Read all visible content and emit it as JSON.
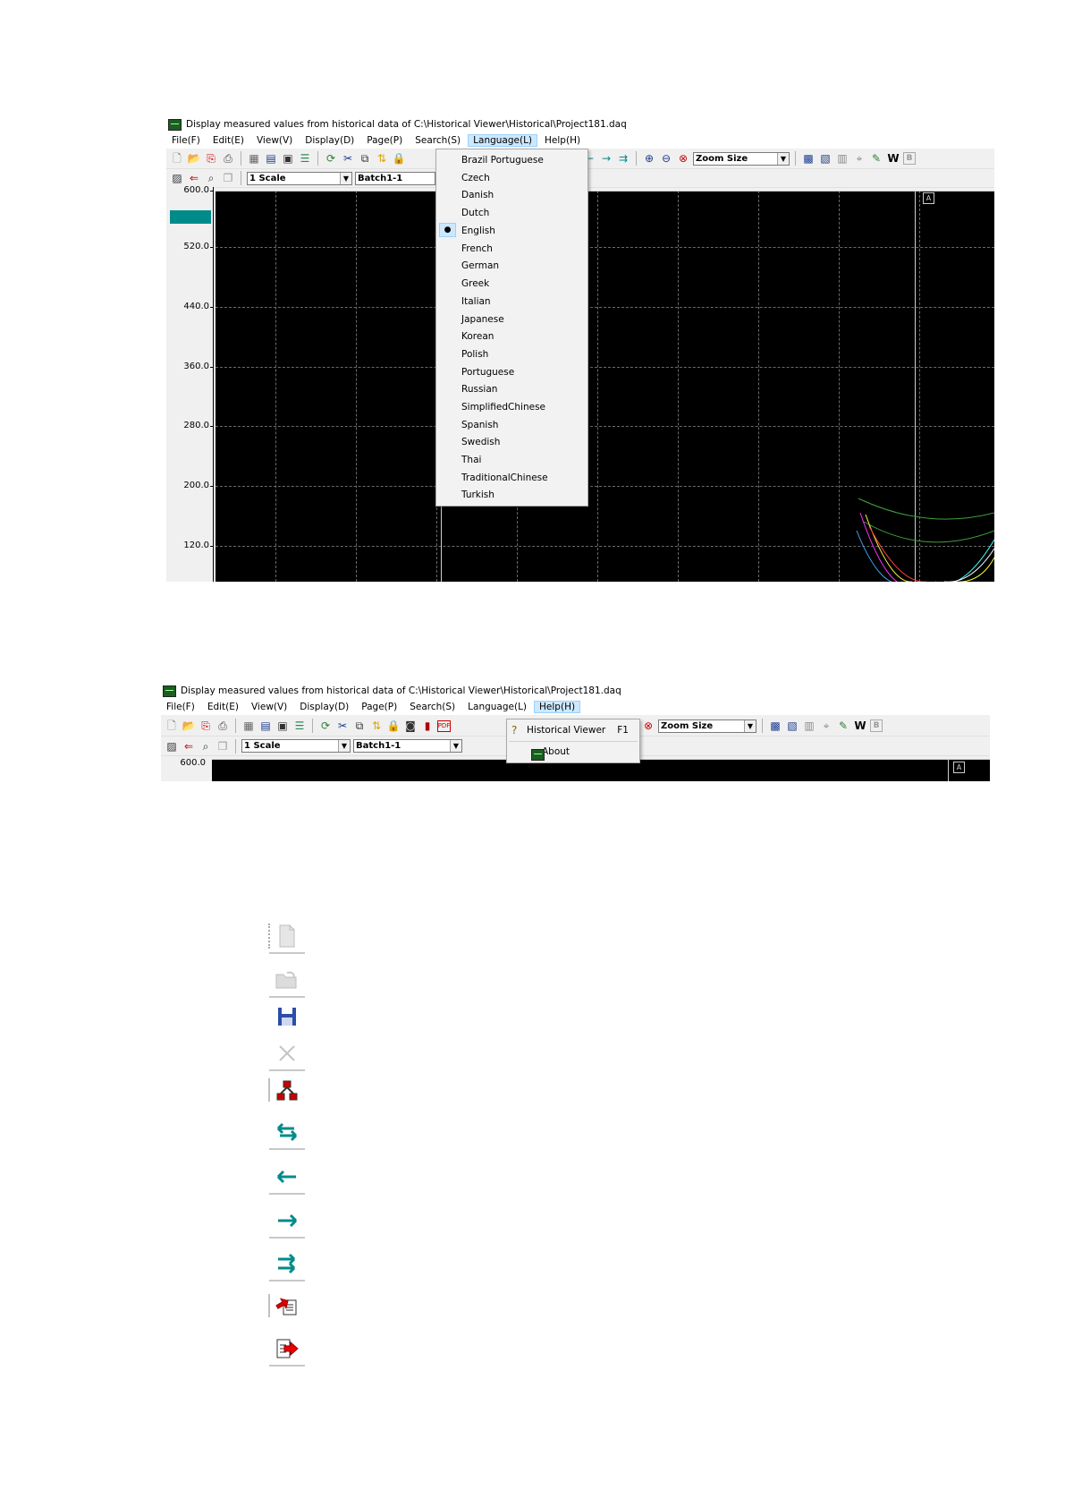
{
  "screen1": {
    "title": "Display measured values from historical data of C:\\Historical Viewer\\Historical\\Project181.daq",
    "menu": [
      "File(F)",
      "Edit(E)",
      "View(V)",
      "Display(D)",
      "Page(P)",
      "Search(S)",
      "Language(L)",
      "Help(H)"
    ],
    "open_menu": "Language(L)",
    "zoom_combo": "Zoom Size",
    "scale_combo": "1 Scale",
    "batch_combo": "Batch1-1",
    "w_label": "W",
    "b_label": "B",
    "marker_label": "A",
    "y_axis_labels": [
      "600.0",
      "520.0",
      "440.0",
      "360.0",
      "280.0",
      "200.0",
      "120.0"
    ],
    "language_menu": {
      "items": [
        "Brazil Portuguese",
        "Czech",
        "Danish",
        "Dutch",
        "English",
        "French",
        "German",
        "Greek",
        "Italian",
        "Japanese",
        "Korean",
        "Polish",
        "Portuguese",
        "Russian",
        "SimplifiedChinese",
        "Spanish",
        "Swedish",
        "Thai",
        "TraditionalChinese",
        "Turkish"
      ],
      "selected": "English"
    },
    "colors": {
      "plot_bg": "#000000",
      "grid": "#6a6a6a",
      "channel_marker": "#008b8b",
      "menu_highlight": "#cce8ff"
    }
  },
  "screen2": {
    "title": "Display measured values from historical data of C:\\Historical Viewer\\Historical\\Project181.daq",
    "menu": [
      "File(F)",
      "Edit(E)",
      "View(V)",
      "Display(D)",
      "Page(P)",
      "Search(S)",
      "Language(L)",
      "Help(H)"
    ],
    "open_menu": "Help(H)",
    "zoom_combo": "Zoom Size",
    "scale_combo": "1 Scale",
    "batch_combo": "Batch1-1",
    "w_label": "W",
    "b_label": "B",
    "marker_label": "A",
    "y_axis_label": "600.0",
    "help_menu": [
      {
        "label": "Historical Viewer",
        "shortcut": "F1",
        "icon": "question-bulb-icon"
      },
      {
        "label": "About",
        "shortcut": "",
        "icon": "app-monitor-icon"
      }
    ]
  },
  "icon_column": [
    {
      "icon": "new-document-icon",
      "state": "disabled"
    },
    {
      "icon": "open-folder-icon",
      "state": "disabled"
    },
    {
      "icon": "save-disk-icon",
      "state": "enabled"
    },
    {
      "icon": "close-x-icon",
      "state": "disabled"
    },
    {
      "icon": "network-tree-icon",
      "state": "enabled"
    },
    {
      "icon": "double-arrow-icon",
      "state": "enabled"
    },
    {
      "icon": "arrow-left-icon",
      "state": "enabled"
    },
    {
      "icon": "arrow-right-icon",
      "state": "enabled"
    },
    {
      "icon": "double-arrow-right-icon",
      "state": "enabled"
    },
    {
      "icon": "export-page-icon",
      "state": "enabled"
    },
    {
      "icon": "exit-page-icon",
      "state": "enabled"
    }
  ]
}
